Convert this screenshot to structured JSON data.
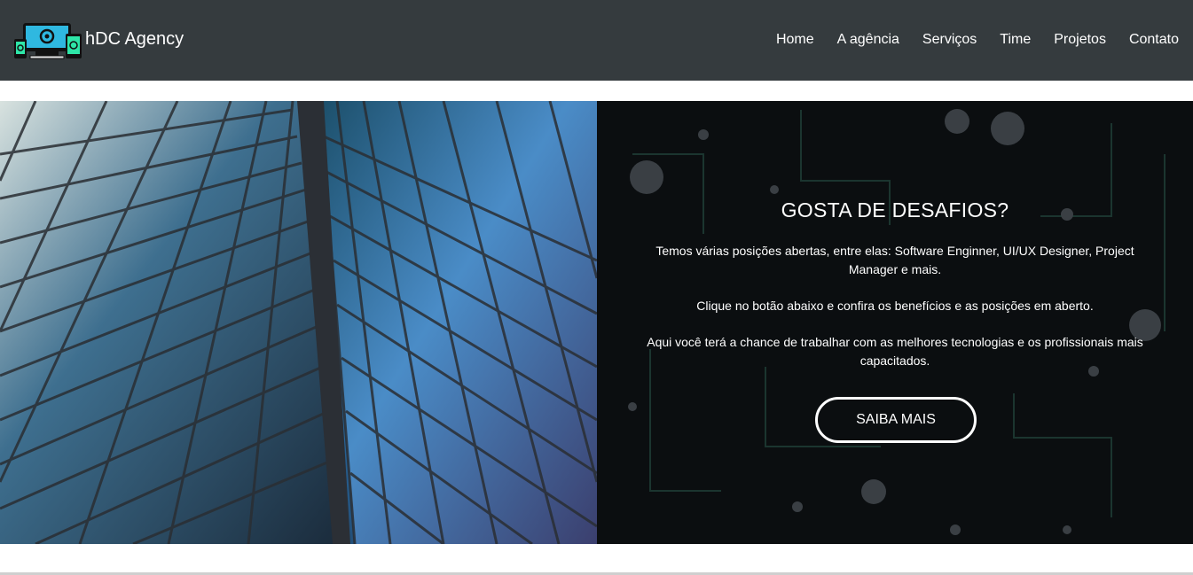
{
  "brand": {
    "name": "hDC Agency",
    "logo_icon": "devices-eye-logo-icon"
  },
  "nav": {
    "items": [
      "Home",
      "A agência",
      "Serviços",
      "Time",
      "Projetos",
      "Contato"
    ]
  },
  "hero": {
    "title": "GOSTA DE DESAFIOS?",
    "paragraphs": [
      "Temos várias posições abertas, entre elas: Software Enginner, UI/UX Designer, Project Manager e mais.",
      "Clique no botão abaixo e confira os benefícios e as posições em aberto.",
      "Aqui você terá a chance de trabalhar com as melhores tecnologias e os profissionais mais capacitados."
    ],
    "cta_label": "SAIBA MAIS"
  },
  "colors": {
    "navbar": "#353b3e",
    "panel": "#0b0e10",
    "logo_accent": "#2ee6a8",
    "logo_screen": "#2fb8e0"
  }
}
